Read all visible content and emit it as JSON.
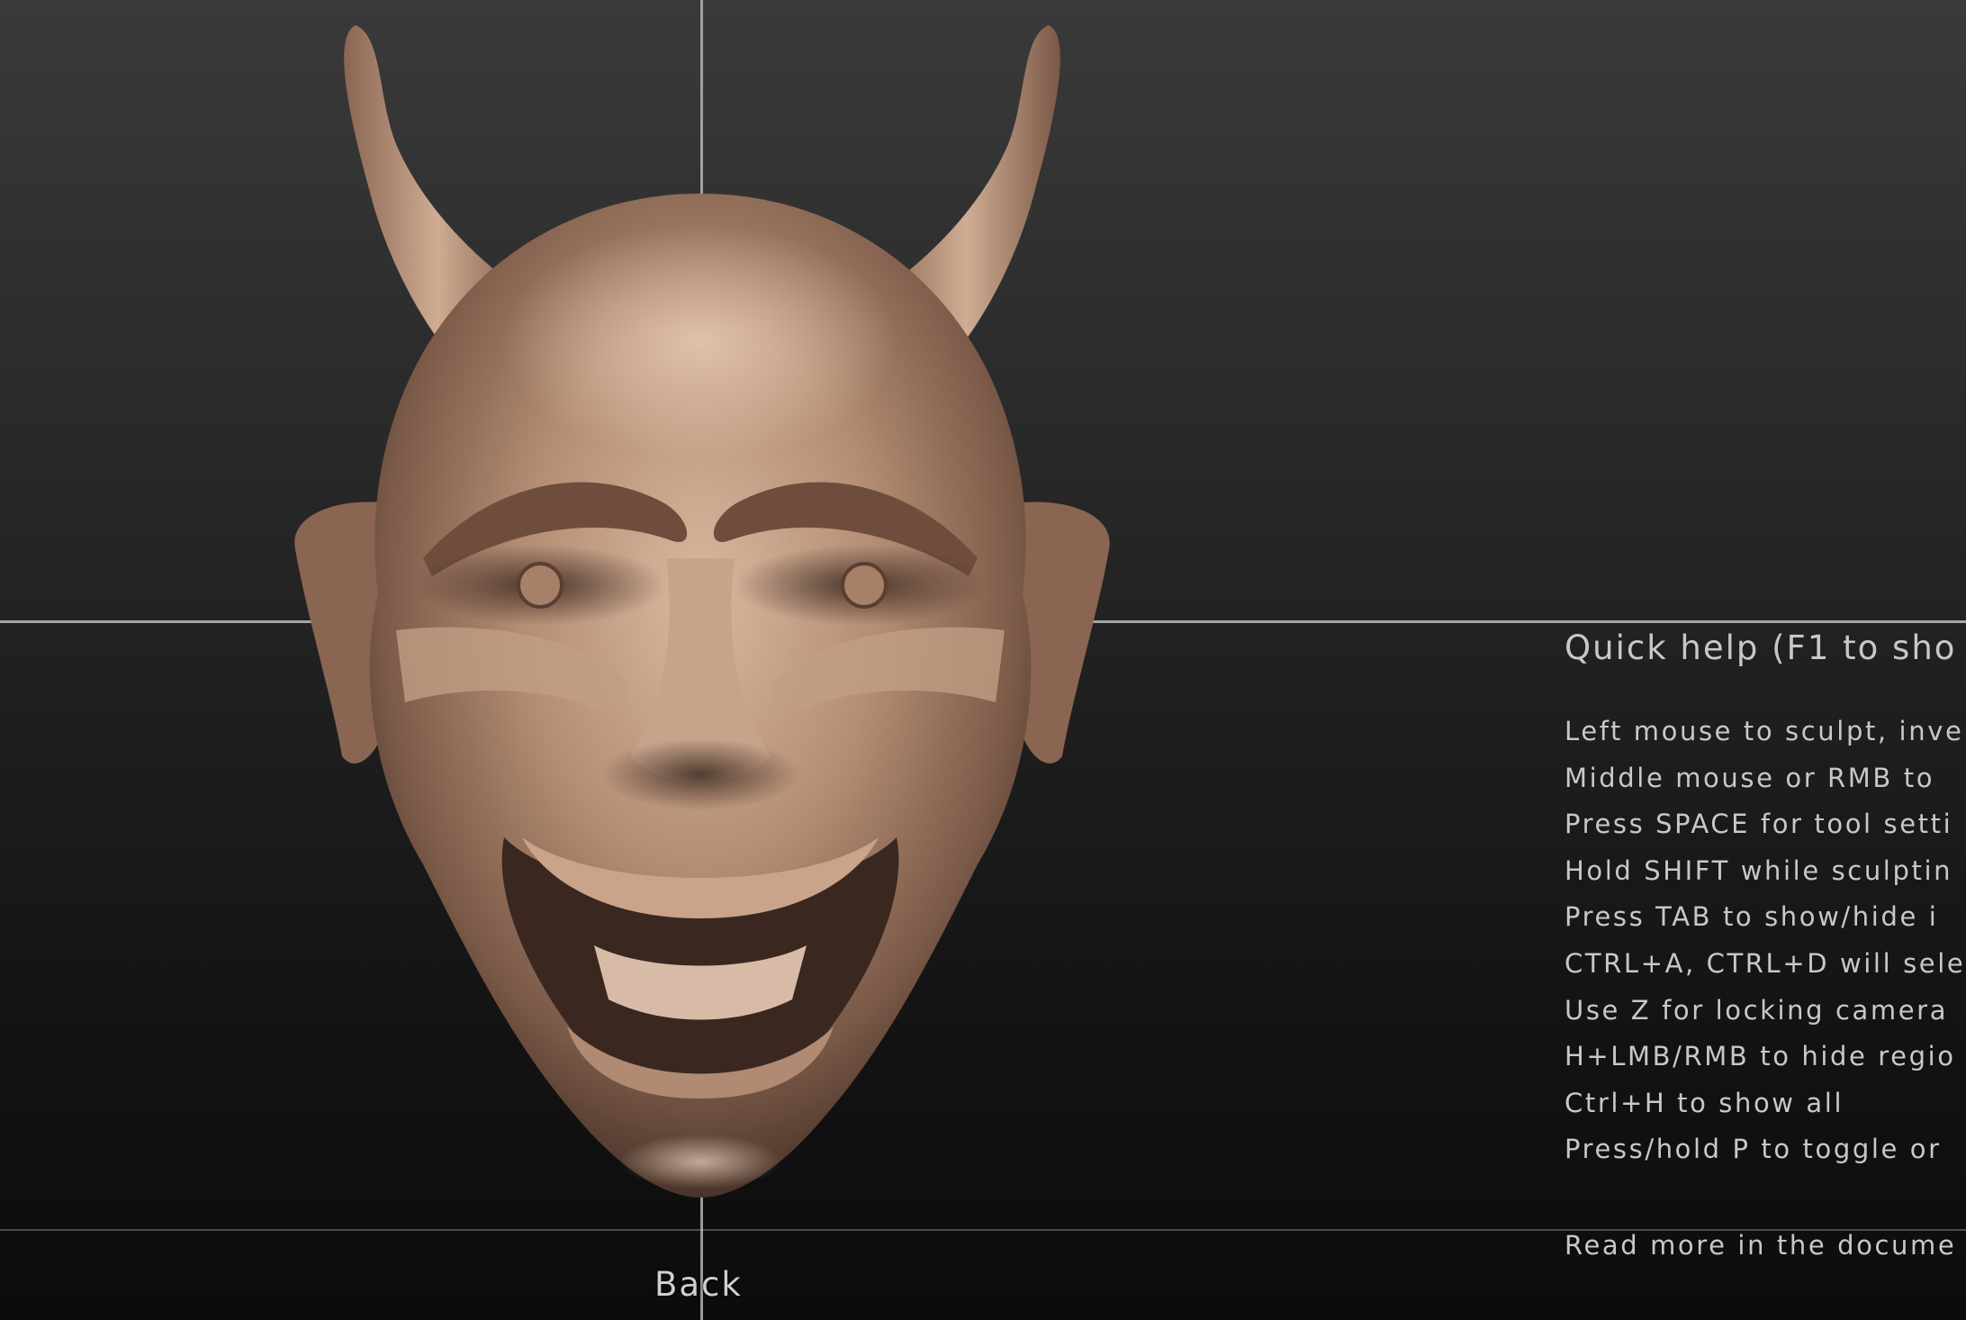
{
  "viewport": {
    "background": "#1a1a1a",
    "guide_color": "#bdbdbd",
    "model_color": "#b08a72"
  },
  "model": {
    "name_icon": "hannya-mask-sculpt"
  },
  "quick_help": {
    "title": "Quick help (F1 to sho",
    "lines": [
      "Left mouse to sculpt, inve",
      "Middle mouse or RMB to",
      "Press SPACE for tool setti",
      "Hold SHIFT while sculptin",
      "Press TAB to show/hide i",
      "CTRL+A, CTRL+D will sele",
      "Use Z for locking camera",
      "H+LMB/RMB to hide regio",
      "Ctrl+H to show all",
      "Press/hold P to toggle or"
    ],
    "footer": "Read more in the docume"
  },
  "view_label": "Back"
}
